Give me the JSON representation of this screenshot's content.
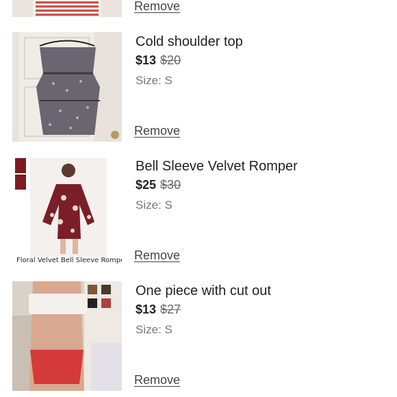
{
  "items": [
    {
      "remove_label": "Remove"
    },
    {
      "title": "Cold shoulder top",
      "price": "$13",
      "original_price": "$20",
      "size": "Size: S",
      "remove_label": "Remove"
    },
    {
      "title": "Bell Sleeve Velvet Romper",
      "price": "$25",
      "original_price": "$30",
      "size": "Size: S",
      "remove_label": "Remove",
      "image_caption": "Floral Velvet Bell Sleeve Romper"
    },
    {
      "title": "One piece with cut out",
      "price": "$13",
      "original_price": "$27",
      "size": "Size: S",
      "remove_label": "Remove"
    }
  ],
  "colors": {
    "text": "#222222",
    "muted": "#777777",
    "link": "#444444"
  }
}
